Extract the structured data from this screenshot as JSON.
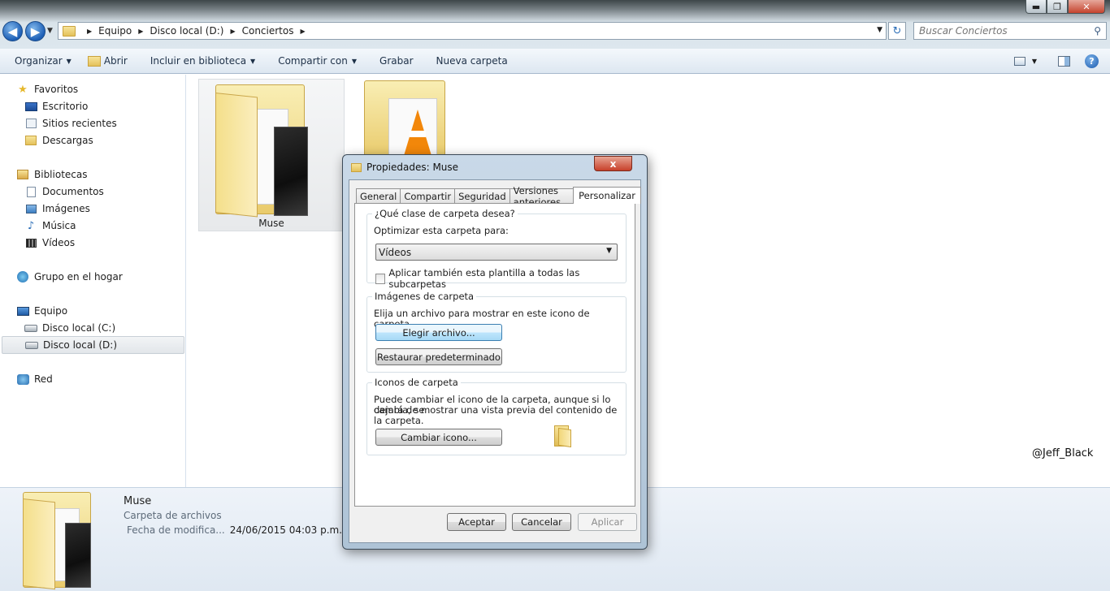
{
  "window": {
    "controls": {
      "minimize": "▬",
      "maximize": "❐",
      "close": "✕"
    }
  },
  "address_bar": {
    "crumbs": [
      "Equipo",
      "Disco local (D:)",
      "Conciertos"
    ],
    "search_placeholder": "Buscar Conciertos"
  },
  "command_bar": {
    "organize": "Organizar",
    "open": "Abrir",
    "include_library": "Incluir en biblioteca",
    "share": "Compartir con",
    "burn": "Grabar",
    "new_folder": "Nueva carpeta"
  },
  "nav_pane": {
    "favorites": "Favoritos",
    "desktop": "Escritorio",
    "recent": "Sitios recientes",
    "downloads": "Descargas",
    "libraries": "Bibliotecas",
    "documents": "Documentos",
    "images": "Imágenes",
    "music": "Música",
    "videos": "Vídeos",
    "homegroup": "Grupo en el hogar",
    "computer": "Equipo",
    "drive_c": "Disco local (C:)",
    "drive_d": "Disco local (D:)",
    "network": "Red"
  },
  "content": {
    "folder_name": "Muse"
  },
  "watermark": "@Jeff_Black",
  "details": {
    "name": "Muse",
    "type": "Carpeta de archivos",
    "date_label": "Fecha de modifica...",
    "date_value": "24/06/2015 04:03 p.m."
  },
  "dialog": {
    "title": "Propiedades: Muse",
    "close": "x",
    "tabs": [
      "General",
      "Compartir",
      "Seguridad",
      "Versiones anteriores",
      "Personalizar"
    ],
    "group1": {
      "legend": "¿Qué clase de carpeta desea?",
      "optimize_label": "Optimizar esta carpeta para:",
      "optimize_value": "Vídeos",
      "apply_sub_label": "Aplicar también esta plantilla a todas las subcarpetas"
    },
    "group2": {
      "legend": "Imágenes de carpeta",
      "text": "Elija un archivo para mostrar en este icono de carpeta.",
      "choose_file": "Elegir archivo...",
      "restore_default": "Restaurar predeterminado"
    },
    "group3": {
      "legend": "Iconos de carpeta",
      "text_line1": "Puede cambiar el icono de la carpeta, aunque si lo cambia, se",
      "text_line2": "dejará de mostrar una vista previa del contenido de la carpeta.",
      "change_icon": "Cambiar icono..."
    },
    "buttons": {
      "accept": "Aceptar",
      "cancel": "Cancelar",
      "apply": "Aplicar"
    }
  }
}
